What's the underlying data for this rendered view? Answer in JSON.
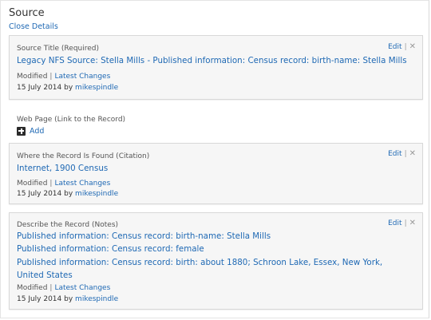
{
  "header": {
    "title": "Source",
    "close_link": "Close Details"
  },
  "source_title": {
    "label": "Source Title (Required)",
    "value": "Legacy NFS Source: Stella Mills - Published information: Census record: birth-name: Stella Mills",
    "modified_label": "Modified",
    "changes_link": "Latest Changes",
    "date": "15 July 2014 by",
    "user": "mikespindle",
    "edit": "Edit",
    "close": "✕"
  },
  "web_page": {
    "label": "Web Page (Link to the Record)",
    "add": "Add"
  },
  "citation": {
    "label": "Where the Record Is Found (Citation)",
    "value": "Internet, 1900 Census",
    "modified_label": "Modified",
    "changes_link": "Latest Changes",
    "date": "15 July 2014 by",
    "user": "mikespindle",
    "edit": "Edit",
    "close": "✕"
  },
  "notes": {
    "label": "Describe the Record (Notes)",
    "lines": [
      "Published information: Census record: birth-name: Stella Mills",
      "Published information: Census record: female",
      "Published information: Census record: birth: about 1880; Schroon Lake, Essex, New York, United States"
    ],
    "modified_label": "Modified",
    "changes_link": "Latest Changes",
    "date": "15 July 2014 by",
    "user": "mikespindle",
    "edit": "Edit",
    "close": "✕"
  },
  "icons": {
    "add": "plus-square-icon",
    "close": "close-icon"
  },
  "colors": {
    "link": "#1f69b4",
    "box_background": "#f6f6f6",
    "box_border": "#d8d8d8"
  }
}
